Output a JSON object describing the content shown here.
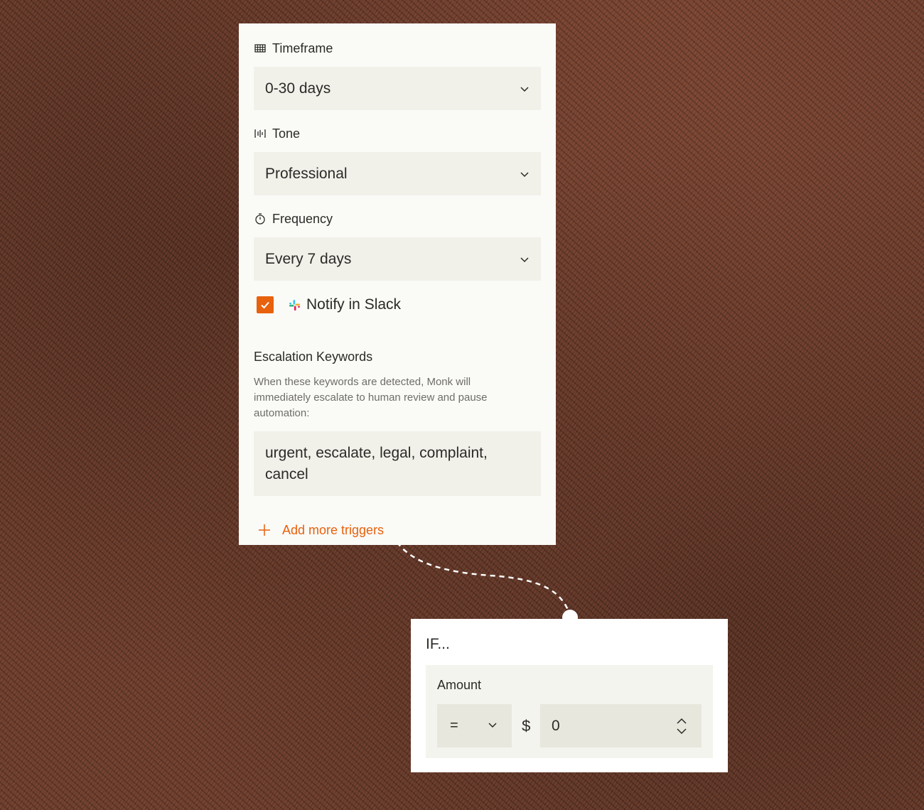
{
  "settings_panel": {
    "timeframe": {
      "label": "Timeframe",
      "value": "0-30 days",
      "icon": "calendar-grid-icon"
    },
    "tone": {
      "label": "Tone",
      "value": "Professional",
      "icon": "voice-wave-icon"
    },
    "frequency": {
      "label": "Frequency",
      "value": "Every 7 days",
      "icon": "stopwatch-icon"
    },
    "notify": {
      "label": "Notify in Slack",
      "checked": true,
      "icon": "slack-icon"
    },
    "escalation": {
      "title": "Escalation Keywords",
      "description": "When these keywords are detected, Monk will immediately escalate to human review and pause automation:",
      "keywords": "urgent, escalate, legal, complaint, cancel"
    },
    "add_trigger_label": "Add more triggers"
  },
  "condition_panel": {
    "title": "IF...",
    "field_label": "Amount",
    "operator": "=",
    "currency_symbol": "$",
    "amount_value": "0"
  },
  "colors": {
    "accent": "#e8610c",
    "panel_bg": "#fafaf7",
    "field_bg": "#f1f1ea",
    "text": "#2b2a27",
    "muted_text": "#6f6d68"
  }
}
